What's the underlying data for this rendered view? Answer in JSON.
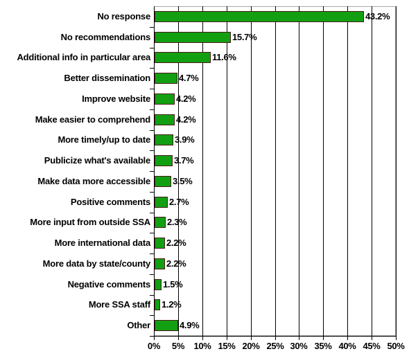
{
  "chart_data": {
    "type": "bar",
    "orientation": "horizontal",
    "title": "",
    "xlabel": "",
    "ylabel": "",
    "xlim": [
      0,
      50
    ],
    "xtick_labels": [
      "0%",
      "5%",
      "10%",
      "15%",
      "20%",
      "25%",
      "30%",
      "35%",
      "40%",
      "45%",
      "50%"
    ],
    "xtick_values": [
      0,
      5,
      10,
      15,
      20,
      25,
      30,
      35,
      40,
      45,
      50
    ],
    "grid": true,
    "legend": false,
    "bar_color": "#12a012",
    "bar_border_color": "#4a1a1a",
    "categories": [
      "No response",
      "No recommendations",
      "Additional info in particular area",
      "Better dissemination",
      "Improve website",
      "Make easier to comprehend",
      "More timely/up to date",
      "Publicize what's available",
      "Make data more accessible",
      "Positive comments",
      "More input from outside SSA",
      "More international data",
      "More data by state/county",
      "Negative comments",
      "More SSA staff",
      "Other"
    ],
    "values": [
      43.2,
      15.7,
      11.6,
      4.7,
      4.2,
      4.2,
      3.9,
      3.7,
      3.5,
      2.7,
      2.3,
      2.2,
      2.2,
      1.5,
      1.2,
      4.9
    ],
    "value_labels": [
      "43.2%",
      "15.7%",
      "11.6%",
      "4.7%",
      "4.2%",
      "4.2%",
      "3.9%",
      "3.7%",
      "3.5%",
      "2.7%",
      "2.3%",
      "2.2%",
      "2.2%",
      "1.5%",
      "1.2%",
      "4.9%"
    ]
  }
}
